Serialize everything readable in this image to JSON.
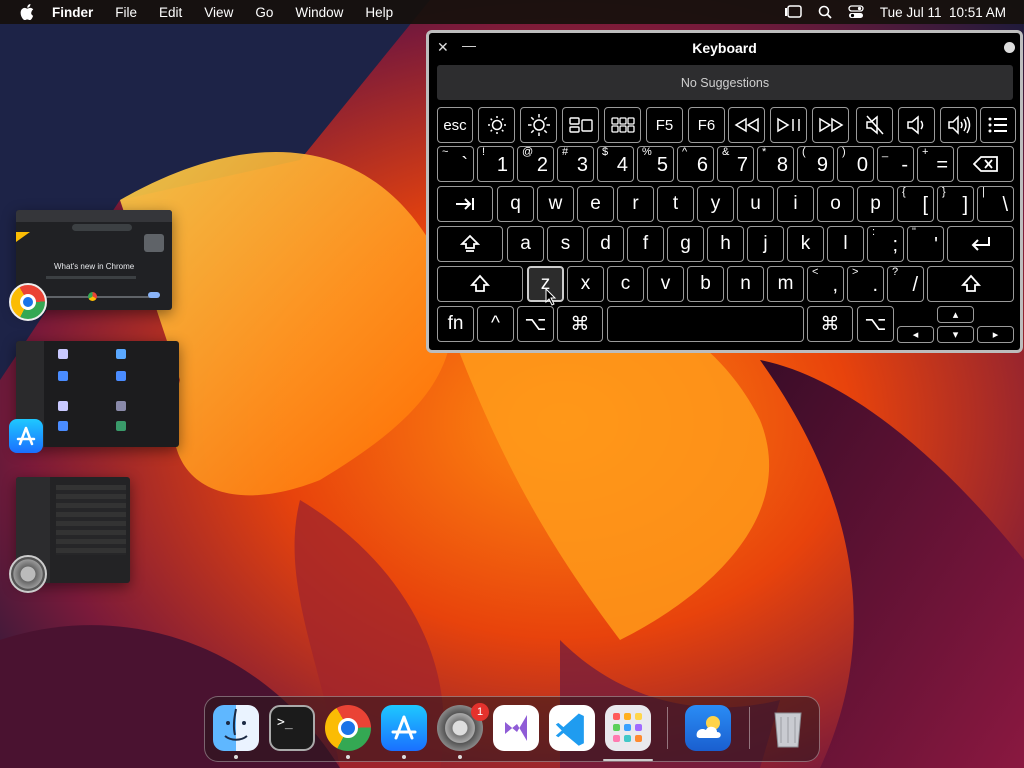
{
  "menubar": {
    "app_name": "Finder",
    "menus": [
      "File",
      "Edit",
      "View",
      "Go",
      "Window",
      "Help"
    ],
    "datetime": "Tue Jul 11  10:51 AM"
  },
  "stage_manager": {
    "chrome_preview_text": "What's new in Chrome"
  },
  "keyboard_viewer": {
    "title": "Keyboard",
    "suggestions": "No Suggestions",
    "fn_row": [
      "esc",
      "brightness-down-icon",
      "brightness-up-icon",
      "mission-control-icon",
      "launchpad-icon",
      "F5",
      "F6",
      "rewind-icon",
      "play-pause-icon",
      "fast-forward-icon",
      "mute-icon",
      "volume-down-icon",
      "volume-up-icon",
      "list-icon"
    ],
    "number_row": [
      {
        "sub": "~",
        "main": "`"
      },
      {
        "sub": "!",
        "main": "1"
      },
      {
        "sub": "@",
        "main": "2"
      },
      {
        "sub": "#",
        "main": "3"
      },
      {
        "sub": "$",
        "main": "4"
      },
      {
        "sub": "%",
        "main": "5"
      },
      {
        "sub": "^",
        "main": "6"
      },
      {
        "sub": "&",
        "main": "7"
      },
      {
        "sub": "*",
        "main": "8"
      },
      {
        "sub": "(",
        "main": "9"
      },
      {
        "sub": ")",
        "main": "0"
      },
      {
        "sub": "_",
        "main": "-"
      },
      {
        "sub": "+",
        "main": "="
      }
    ],
    "qwerty_row": [
      "q",
      "w",
      "e",
      "r",
      "t",
      "y",
      "u",
      "i",
      "o",
      "p"
    ],
    "qwerty_brackets": [
      {
        "sub": "{",
        "main": "["
      },
      {
        "sub": "}",
        "main": "]"
      },
      {
        "sub": "|",
        "main": "\\"
      }
    ],
    "home_row": [
      "a",
      "s",
      "d",
      "f",
      "g",
      "h",
      "j",
      "k",
      "l"
    ],
    "home_punct": [
      {
        "sub": ":",
        "main": ";"
      },
      {
        "sub": "\"",
        "main": "'"
      }
    ],
    "bottom_row": [
      "z",
      "x",
      "c",
      "v",
      "b",
      "n",
      "m"
    ],
    "bottom_punct": [
      {
        "sub": "<",
        "main": ","
      },
      {
        "sub": ">",
        "main": "."
      },
      {
        "sub": "?",
        "main": "/"
      }
    ],
    "highlighted_key": "z",
    "mod_row": {
      "fn": "fn",
      "ctrl": "^",
      "opt": "⌥",
      "cmd": "⌘"
    }
  },
  "dock": {
    "apps": [
      "finder-icon",
      "terminal-icon",
      "chrome-icon",
      "app-store-icon",
      "system-settings-icon",
      "visual-studio-icon",
      "vscode-icon",
      "launchpad-icon",
      "weather-icon",
      "trash-icon"
    ],
    "settings_badge": "1"
  }
}
